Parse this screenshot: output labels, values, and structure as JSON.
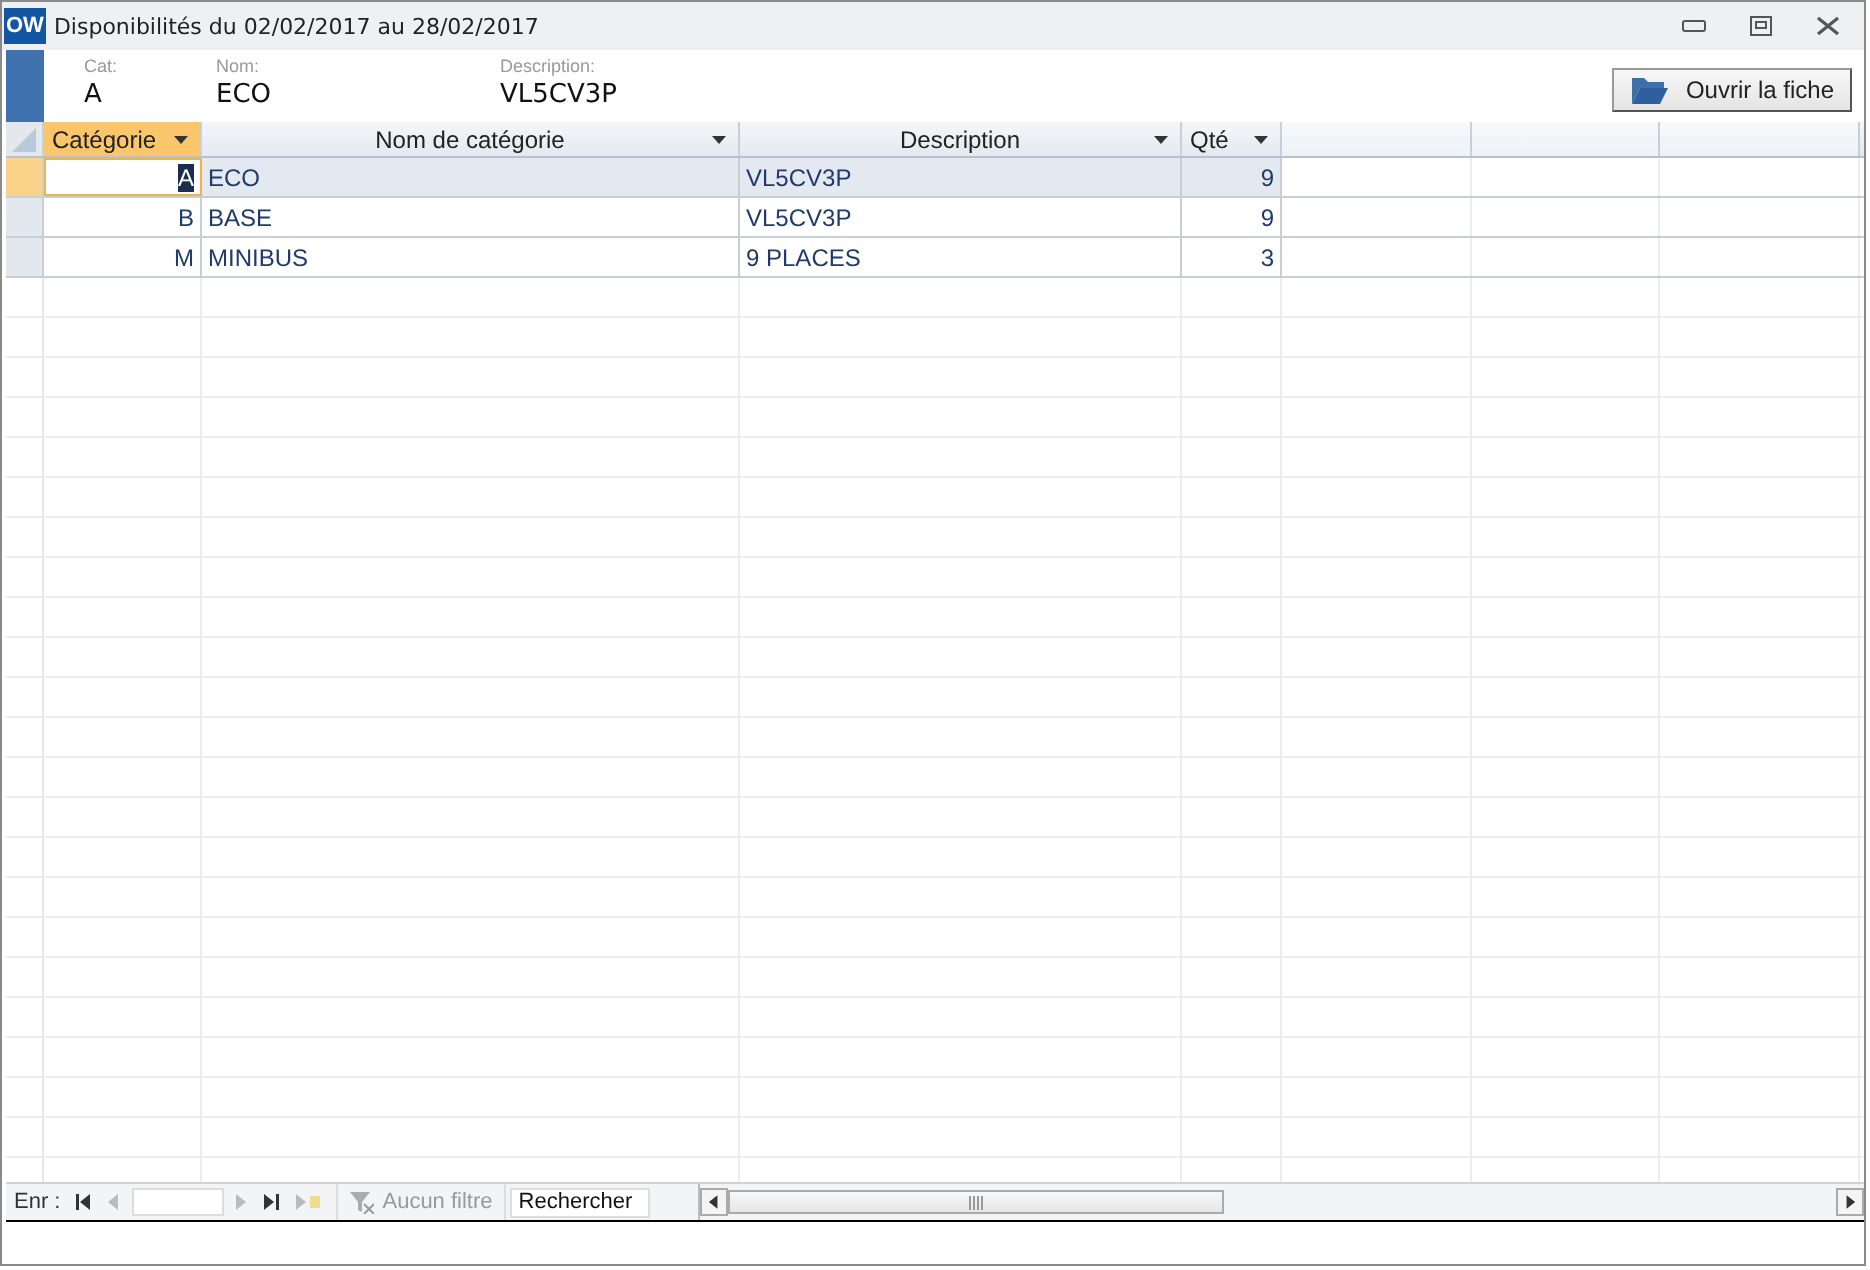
{
  "window": {
    "app_icon": "OW",
    "title": "Disponibilités du 02/02/2017 au 28/02/2017"
  },
  "fields": [
    {
      "label": "Cat:",
      "value": "A"
    },
    {
      "label": "Nom:",
      "value": "ECO"
    },
    {
      "label": "Description:",
      "value": "VL5CV3P"
    }
  ],
  "open_button": "Ouvrir la fiche",
  "table": {
    "columns": [
      {
        "label": "Catégorie",
        "active": true
      },
      {
        "label": "Nom de catégorie",
        "active": false
      },
      {
        "label": "Description",
        "active": false
      },
      {
        "label": "Qté",
        "active": false
      }
    ],
    "rows": [
      {
        "selected": true,
        "cells": [
          "A",
          "ECO",
          "VL5CV3P",
          "9"
        ]
      },
      {
        "selected": false,
        "cells": [
          "B",
          "BASE",
          "VL5CV3P",
          "9"
        ]
      },
      {
        "selected": false,
        "cells": [
          "M",
          "MINIBUS",
          "9 PLACES",
          "3"
        ]
      }
    ]
  },
  "navigation": {
    "label": "Enr :",
    "filter": "Aucun filtre",
    "search_placeholder": "Rechercher"
  }
}
